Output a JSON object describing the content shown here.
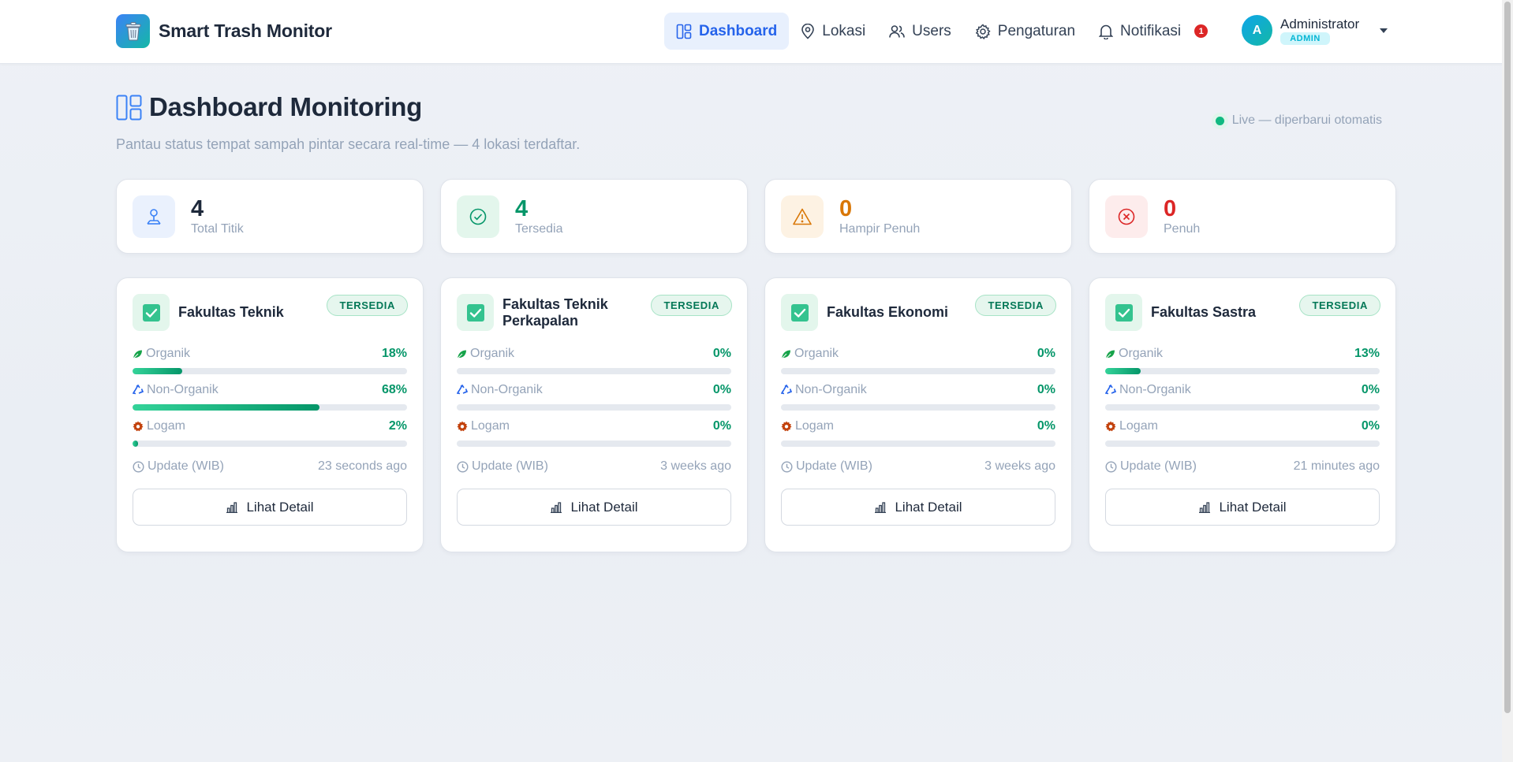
{
  "app": {
    "title": "Smart Trash Monitor"
  },
  "nav": {
    "items": [
      {
        "label": "Dashboard",
        "icon": "dashboard-icon",
        "active": true
      },
      {
        "label": "Lokasi",
        "icon": "map-pin-icon"
      },
      {
        "label": "Users",
        "icon": "users-icon"
      },
      {
        "label": "Pengaturan",
        "icon": "gear-icon"
      },
      {
        "label": "Notifikasi",
        "icon": "bell-icon",
        "count": "1"
      }
    ]
  },
  "user": {
    "initial": "A",
    "name": "Administrator",
    "role": "ADMIN"
  },
  "page": {
    "title": "Dashboard Monitoring",
    "subtitle": "Pantau status tempat sampah pintar secara real-time — 4 lokasi terdaftar.",
    "live": "Live — diperbarui otomatis"
  },
  "stats": [
    {
      "value": "4",
      "label": "Total Titik",
      "color": "#1e293b"
    },
    {
      "value": "4",
      "label": "Tersedia",
      "color": "#059669"
    },
    {
      "value": "0",
      "label": "Hampir Penuh",
      "color": "#d97706"
    },
    {
      "value": "0",
      "label": "Penuh",
      "color": "#dc2626"
    }
  ],
  "metric_labels": {
    "organic": "Organik",
    "inorganic": "Non-Organik",
    "metal": "Logam"
  },
  "update_label": "Update (WIB)",
  "detail_label": "Lihat Detail",
  "locations": [
    {
      "name": "Fakultas Teknik",
      "status": "TERSEDIA",
      "organic": 18,
      "inorganic": 68,
      "metal": 2,
      "updated": "23 seconds ago"
    },
    {
      "name": "Fakultas Teknik Perkapalan",
      "status": "TERSEDIA",
      "organic": 0,
      "inorganic": 0,
      "metal": 0,
      "updated": "3 weeks ago"
    },
    {
      "name": "Fakultas Ekonomi",
      "status": "TERSEDIA",
      "organic": 0,
      "inorganic": 0,
      "metal": 0,
      "updated": "3 weeks ago"
    },
    {
      "name": "Fakultas Sastra",
      "status": "TERSEDIA",
      "organic": 13,
      "inorganic": 0,
      "metal": 0,
      "updated": "21 minutes ago"
    }
  ]
}
